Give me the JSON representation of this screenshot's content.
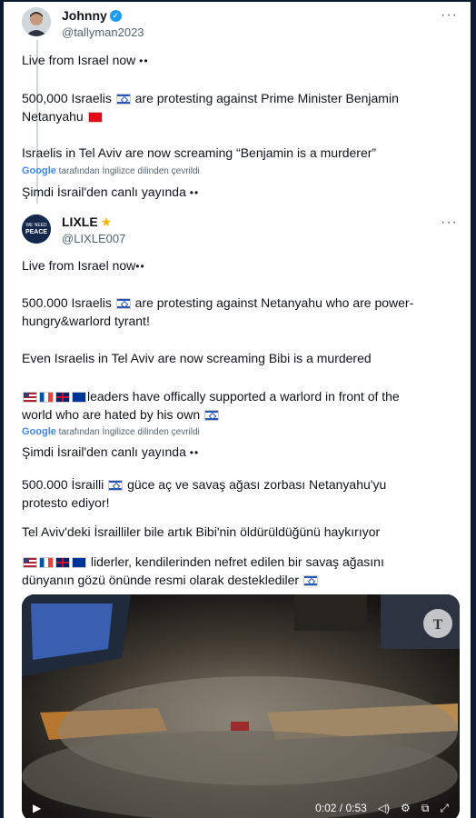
{
  "tweet1": {
    "author_name": "Johnny",
    "author_handle": "@tallyman2023",
    "more": "···",
    "lines": {
      "l1": "Live from Israel now",
      "l2a": "500,000 Israelis",
      "l2b": "are protesting against Prime Minister Benjamin",
      "l3": "Netanyahu",
      "l4": "Israelis in Tel Aviv are now screaming “Benjamin is a murderer”",
      "translated": "Şimdi İsrail'den canlı yayında"
    },
    "translate_note": {
      "brand": "Google",
      "text": "tarafından İngilizce dilinden çevrildi"
    }
  },
  "tweet2": {
    "author_name": "LIXLE",
    "author_handle": "@LIXLE007",
    "more": "···",
    "avatar_text": "WE NEED PEACE",
    "lines": {
      "l1": "Live from Israel now",
      "l2a": "500.000 Israelis",
      "l2b": "are protesting against Netanyahu who are power-",
      "l3": "hungry&warlord tyrant!",
      "l4": "Even Israelis in Tel Aviv are now screaming Bibi is a murdered",
      "l5": "leaders have offically supported a warlord in front of the",
      "l6": "world who are hated by his own",
      "tr1": "Şimdi İsrail'den canlı yayında",
      "tr2a": "500.000 İsrailli",
      "tr2b": "güce aç ve savaş ağası zorbası Netanyahu'yu",
      "tr3": "protesto ediyor!",
      "tr4": "Tel Aviv'deki İsrailliler bile artık Bibi'nin öldürüldüğünü haykırıyor",
      "tr5": "liderler, kendilerinden nefret edilen bir savaş ağasını",
      "tr6": "dünyanın gözü önünde resmi olarak desteklediler"
    },
    "translate_note": {
      "brand": "Google",
      "text": "tarafından İngilizce dilinden çevrildi"
    }
  },
  "video": {
    "time": "0:02 / 0:53",
    "watermark": "T"
  },
  "colors": {
    "accent": "#1d9bf0",
    "text": "#0f1419",
    "muted": "#536471",
    "frame_bg": "#0b1a2e"
  }
}
